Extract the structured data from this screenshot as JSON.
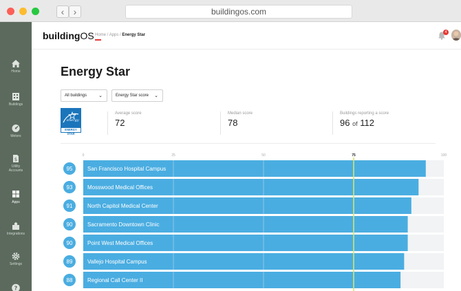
{
  "browser": {
    "url": "buildingos.com"
  },
  "sidebar": {
    "items": [
      {
        "label": "Home",
        "icon": "home-icon"
      },
      {
        "label": "Buildings",
        "icon": "buildings-icon"
      },
      {
        "label": "Meters",
        "icon": "meters-icon"
      },
      {
        "label": "Utility Accounts",
        "icon": "utility-accounts-icon"
      },
      {
        "label": "Apps",
        "icon": "apps-icon"
      },
      {
        "label": "Integrations",
        "icon": "integrations-icon"
      },
      {
        "label": "Settings",
        "icon": "settings-icon"
      }
    ]
  },
  "header": {
    "logo_main": "building",
    "logo_os": "OS",
    "breadcrumb": {
      "home": "Home",
      "sep1": " / ",
      "apps": "Apps",
      "sep2": " / ",
      "current": "Energy Star"
    },
    "notification_count": "4"
  },
  "page": {
    "title": "Energy Star"
  },
  "filters": {
    "buildings": "All buildings",
    "metric": "Energy Star score"
  },
  "logo_text": "ENERGY STAR",
  "stats": {
    "average": {
      "label": "Average score",
      "value": "72"
    },
    "median": {
      "label": "Median score",
      "value": "78"
    },
    "reporting": {
      "label": "Buildings reporting a score",
      "value": "96",
      "of": "of",
      "total": "112"
    }
  },
  "colors": {
    "bar": "#4aade1",
    "track": "#f1f3f4",
    "marker": "#d7e46b",
    "badge": "#4aade1"
  },
  "chart_data": {
    "type": "bar",
    "orientation": "horizontal",
    "xlim": [
      0,
      100
    ],
    "ticks": [
      0,
      25,
      50,
      75,
      100
    ],
    "marker": 75,
    "categories": [
      "San Francisco Hospital Campus",
      "Mosswood Medical Offices",
      "North Capitol Medical Center",
      "Sacramento Downtown Clinic",
      "Point West Medical Offices",
      "Vallejo Hospital Campus",
      "Regional Call Center II"
    ],
    "values": [
      95,
      93,
      91,
      90,
      90,
      89,
      88
    ]
  }
}
